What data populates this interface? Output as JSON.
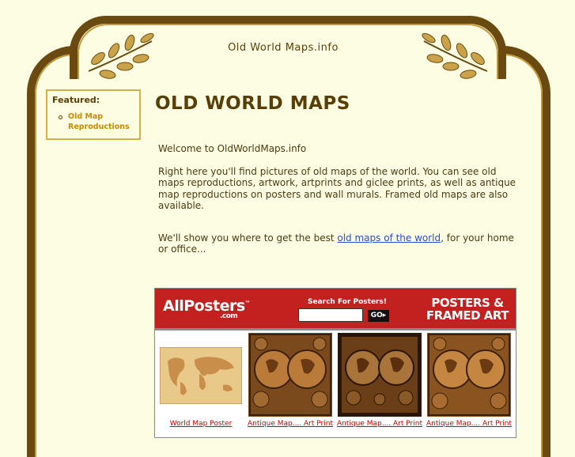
{
  "header": {
    "site_title": "Old World Maps.info"
  },
  "sidebar": {
    "heading": "Featured:",
    "items": [
      {
        "label": "Old Map Reproductions"
      }
    ]
  },
  "main": {
    "title": "OLD WORLD MAPS",
    "welcome": "Welcome to OldWorldMaps.info",
    "intro": "Right here you'll find pictures of old maps of the world. You can see old maps reproductions, artwork, artprints and giclee prints, as well as antique map reproductions on posters and wall murals. Framed old maps are also available.",
    "cta_before": "We'll show you where to get the best ",
    "cta_link": "old maps of the world",
    "cta_after": ", for your home or office..."
  },
  "allposters": {
    "logo": "AllPosters",
    "logo_tm": "™",
    "logo_com": ".com",
    "search_label": "Search For Posters!",
    "search_value": "",
    "go_label": "GO▸",
    "tagline_line1": "POSTERS &",
    "tagline_line2": "FRAMED ART",
    "products": [
      {
        "caption": "World Map Poster"
      },
      {
        "caption": "Antique Map.... Art Print"
      },
      {
        "caption": "Antique Map.... Art Print"
      },
      {
        "caption": "Antique Map.... Art Print"
      }
    ]
  },
  "colors": {
    "background": "#fdfde3",
    "frame_dark": "#6a4a10",
    "frame_gold": "#c49a3a",
    "heading_brown": "#5a3e08",
    "link_blue": "#2a4ad0",
    "allposters_red": "#c32020"
  }
}
